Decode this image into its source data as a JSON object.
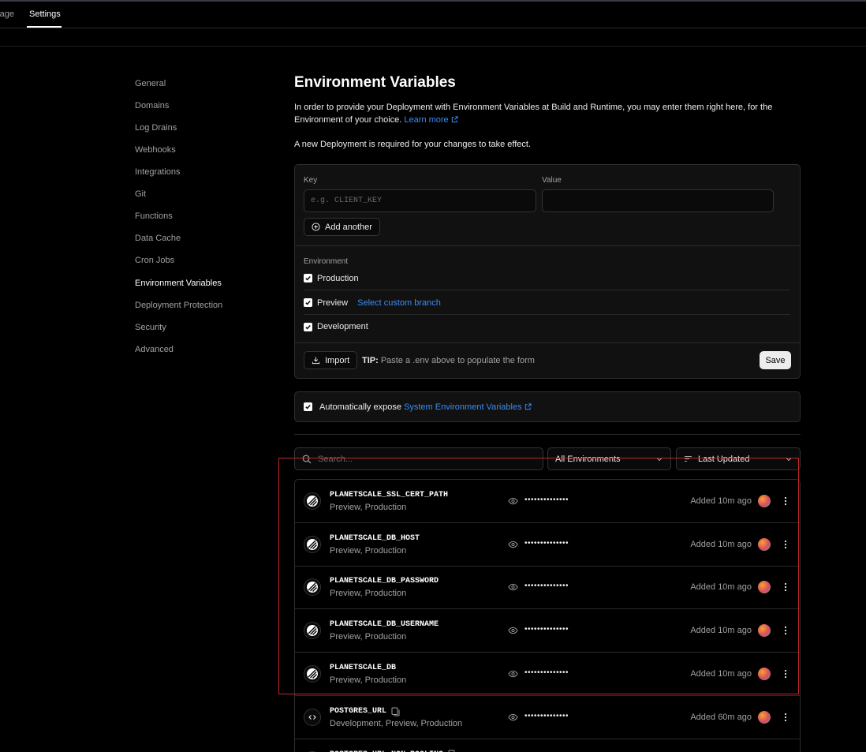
{
  "tabs": {
    "partial_label": "rage",
    "active_label": "Settings"
  },
  "sidebar": {
    "items": [
      {
        "label": "General"
      },
      {
        "label": "Domains"
      },
      {
        "label": "Log Drains"
      },
      {
        "label": "Webhooks"
      },
      {
        "label": "Integrations"
      },
      {
        "label": "Git"
      },
      {
        "label": "Functions"
      },
      {
        "label": "Data Cache"
      },
      {
        "label": "Cron Jobs"
      },
      {
        "label": "Environment Variables",
        "active": true
      },
      {
        "label": "Deployment Protection"
      },
      {
        "label": "Security"
      },
      {
        "label": "Advanced"
      }
    ]
  },
  "page": {
    "title": "Environment Variables",
    "description": "In order to provide your Deployment with Environment Variables at Build and Runtime, you may enter them right here, for the Environment of your choice.",
    "learn_more": "Learn more",
    "note": "A new Deployment is required for your changes to take effect."
  },
  "form": {
    "key_label": "Key",
    "key_placeholder": "e.g. CLIENT_KEY",
    "value_label": "Value",
    "value_value": "",
    "add_another": "Add another",
    "environment_label": "Environment",
    "environments": [
      {
        "label": "Production",
        "checked": true
      },
      {
        "label": "Preview",
        "checked": true,
        "extra_link": "Select custom branch"
      },
      {
        "label": "Development",
        "checked": true
      }
    ],
    "import_label": "Import",
    "tip_bold": "TIP:",
    "tip_text": "Paste a .env above to populate the form",
    "save_label": "Save"
  },
  "expose": {
    "checked": true,
    "text": "Automatically expose",
    "link": "System Environment Variables"
  },
  "filters": {
    "search_placeholder": "Search...",
    "env_filter": "All Environments",
    "sort": "Last Updated"
  },
  "variables": [
    {
      "name": "PLANETSCALE_SSL_CERT_PATH",
      "envs": "Preview, Production",
      "masked": "••••••••••••••",
      "time": "Added 10m ago",
      "icon": "planetscale-icon",
      "copy": false
    },
    {
      "name": "PLANETSCALE_DB_HOST",
      "envs": "Preview, Production",
      "masked": "••••••••••••••",
      "time": "Added 10m ago",
      "icon": "planetscale-icon",
      "copy": false
    },
    {
      "name": "PLANETSCALE_DB_PASSWORD",
      "envs": "Preview, Production",
      "masked": "••••••••••••••",
      "time": "Added 10m ago",
      "icon": "planetscale-icon",
      "copy": false
    },
    {
      "name": "PLANETSCALE_DB_USERNAME",
      "envs": "Preview, Production",
      "masked": "••••••••••••••",
      "time": "Added 10m ago",
      "icon": "planetscale-icon",
      "copy": false
    },
    {
      "name": "PLANETSCALE_DB",
      "envs": "Preview, Production",
      "masked": "••••••••••••••",
      "time": "Added 10m ago",
      "icon": "planetscale-icon",
      "copy": false
    },
    {
      "name": "POSTGRES_URL",
      "envs": "Development, Preview, Production",
      "masked": "••••••••••••••",
      "time": "Added 60m ago",
      "icon": "code-icon",
      "copy": true
    },
    {
      "name": "POSTGRES_URL_NON_POOLING",
      "envs": "",
      "masked": "",
      "time": "",
      "icon": "code-icon",
      "copy": true
    }
  ],
  "colors": {
    "accent_link": "#3b8cf5",
    "highlight_box": "#c0262b",
    "background": "#000000"
  }
}
